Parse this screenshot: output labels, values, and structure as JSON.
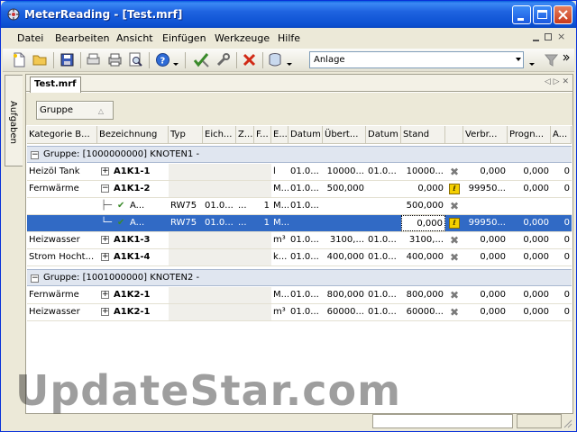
{
  "window": {
    "title": "MeterReading - [Test.mrf]"
  },
  "menu": [
    "Datei",
    "Bearbeiten",
    "Ansicht",
    "Einfügen",
    "Werkzeuge",
    "Hilfe"
  ],
  "toolbar": {
    "combo_value": "Anlage"
  },
  "side_panel": {
    "label": "Aufgaben"
  },
  "document": {
    "tab_label": "Test.mrf",
    "group_chip": "Gruppe"
  },
  "columns": [
    "Kategorie B...",
    "Bezeichnung",
    "Typ",
    "Eich...",
    "Z...",
    "F...",
    "E...",
    "Datum",
    "Übert...",
    "Datum",
    "Stand",
    "",
    "Verbr...",
    "Progn...",
    "A..."
  ],
  "groups": [
    {
      "label": "Gruppe: [1000000000] KNOTEN1 -",
      "rows": [
        {
          "kategorie": "Heizöl Tank",
          "expander": "+",
          "bezeichnung": "A1K1-1",
          "typ": "",
          "eich": "",
          "z": "",
          "f": "",
          "e": "l",
          "datum": "01.0...",
          "uebert": "10000...",
          "datum2": "01.0...",
          "stand": "10000...",
          "status": "x",
          "verbr": "0,000",
          "progn": "0,000",
          "a": "0",
          "selected": false
        },
        {
          "kategorie": "Fernwärme",
          "expander": "-",
          "bezeichnung": "A1K1-2",
          "typ": "",
          "eich": "",
          "z": "",
          "f": "",
          "e": "M...",
          "datum": "01.0...",
          "uebert": "500,000",
          "datum2": "",
          "stand": "0,000",
          "status": "warn",
          "verbr": "99950...",
          "progn": "0,000",
          "a": "0",
          "selected": false
        },
        {
          "kategorie": "",
          "expander": "",
          "bezeichnung": "A...",
          "typ": "RW75",
          "eich": "01.0...",
          "z": "...",
          "f": "1",
          "e": "M...",
          "datum": "01.0...",
          "uebert": "",
          "datum2": "",
          "stand": "500,000",
          "status": "x",
          "verbr": "",
          "progn": "",
          "a": "",
          "selected": false,
          "child": true
        },
        {
          "kategorie": "",
          "expander": "",
          "bezeichnung": "A...",
          "typ": "RW75",
          "eich": "01.0...",
          "z": "...",
          "f": "1",
          "e": "M...",
          "datum": "",
          "uebert": "",
          "datum2": "",
          "stand": "0,000",
          "status": "warn",
          "verbr": "99950...",
          "progn": "0,000",
          "a": "0",
          "selected": true,
          "child": true
        },
        {
          "kategorie": "Heizwasser",
          "expander": "+",
          "bezeichnung": "A1K1-3",
          "typ": "",
          "eich": "",
          "z": "",
          "f": "",
          "e": "m³",
          "datum": "01.0...",
          "uebert": "3100,...",
          "datum2": "01.0...",
          "stand": "3100,...",
          "status": "x",
          "verbr": "0,000",
          "progn": "0,000",
          "a": "0",
          "selected": false
        },
        {
          "kategorie": "Strom Hocht...",
          "expander": "+",
          "bezeichnung": "A1K1-4",
          "typ": "",
          "eich": "",
          "z": "",
          "f": "",
          "e": "k...",
          "datum": "01.0...",
          "uebert": "400,000",
          "datum2": "01.0...",
          "stand": "400,000",
          "status": "x",
          "verbr": "0,000",
          "progn": "0,000",
          "a": "0",
          "selected": false
        }
      ]
    },
    {
      "label": "Gruppe: [1001000000] KNOTEN2 -",
      "rows": [
        {
          "kategorie": "Fernwärme",
          "expander": "+",
          "bezeichnung": "A1K2-1",
          "typ": "",
          "eich": "",
          "z": "",
          "f": "",
          "e": "M...",
          "datum": "01.0...",
          "uebert": "800,000",
          "datum2": "01.0...",
          "stand": "800,000",
          "status": "x",
          "verbr": "0,000",
          "progn": "0,000",
          "a": "0",
          "selected": false
        },
        {
          "kategorie": "Heizwasser",
          "expander": "+",
          "bezeichnung": "A1K2-1",
          "typ": "",
          "eich": "",
          "z": "",
          "f": "",
          "e": "m³",
          "datum": "01.0...",
          "uebert": "60000...",
          "datum2": "01.0...",
          "stand": "60000...",
          "status": "x",
          "verbr": "0,000",
          "progn": "0,000",
          "a": "0",
          "selected": false
        }
      ]
    }
  ],
  "watermark": "UpdateStar.com",
  "colors": {
    "selection": "#316ac5",
    "group_row": "#e0e6f0",
    "titlebar": "#0b4fd1"
  }
}
